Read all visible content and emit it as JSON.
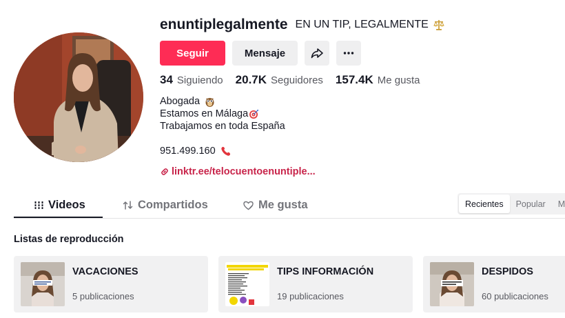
{
  "profile": {
    "username": "enuntiplegalmente",
    "nickname": "EN UN TIP, LEGALMENTE",
    "nickname_icon": "scales-of-justice-icon"
  },
  "actions": {
    "follow_label": "Seguir",
    "message_label": "Mensaje",
    "share_icon": "share-icon",
    "more_icon": "more-options-icon"
  },
  "stats": [
    {
      "value": "34",
      "label": "Siguiendo"
    },
    {
      "value": "20.7K",
      "label": "Seguidores"
    },
    {
      "value": "157.4K",
      "label": "Me gusta"
    }
  ],
  "bio": {
    "line1": "Abogada",
    "line1_icon": "owl-icon",
    "line2": "Estamos en Málaga",
    "line2_icon": "target-icon",
    "line3": "Trabajamos en toda España"
  },
  "contact": {
    "phone": "951.499.160",
    "phone_icon": "telephone-icon",
    "link": "linktr.ee/telocuentoenuntiple..."
  },
  "tabs": [
    {
      "label": "Videos",
      "icon": "grid-lines-icon",
      "active": true
    },
    {
      "label": "Compartidos",
      "icon": "repost-icon",
      "active": false
    },
    {
      "label": "Me gusta",
      "icon": "heart-icon",
      "active": false
    }
  ],
  "sort": {
    "options": [
      "Recientes",
      "Popular",
      "Más"
    ],
    "selected": "Recientes"
  },
  "playlists": {
    "title": "Listas de reproducción",
    "items": [
      {
        "title": "VACACIONES",
        "count": "5 publicaciones"
      },
      {
        "title": "TIPS INFORMACIÓN",
        "count": "19 publicaciones"
      },
      {
        "title": "DESPIDOS",
        "count": "60 publicaciones"
      }
    ]
  },
  "colors": {
    "accent": "#fe2c55",
    "link": "#c8244a",
    "text": "#161823",
    "secondary_text": "#57585f",
    "card_bg": "#f1f1f2"
  }
}
